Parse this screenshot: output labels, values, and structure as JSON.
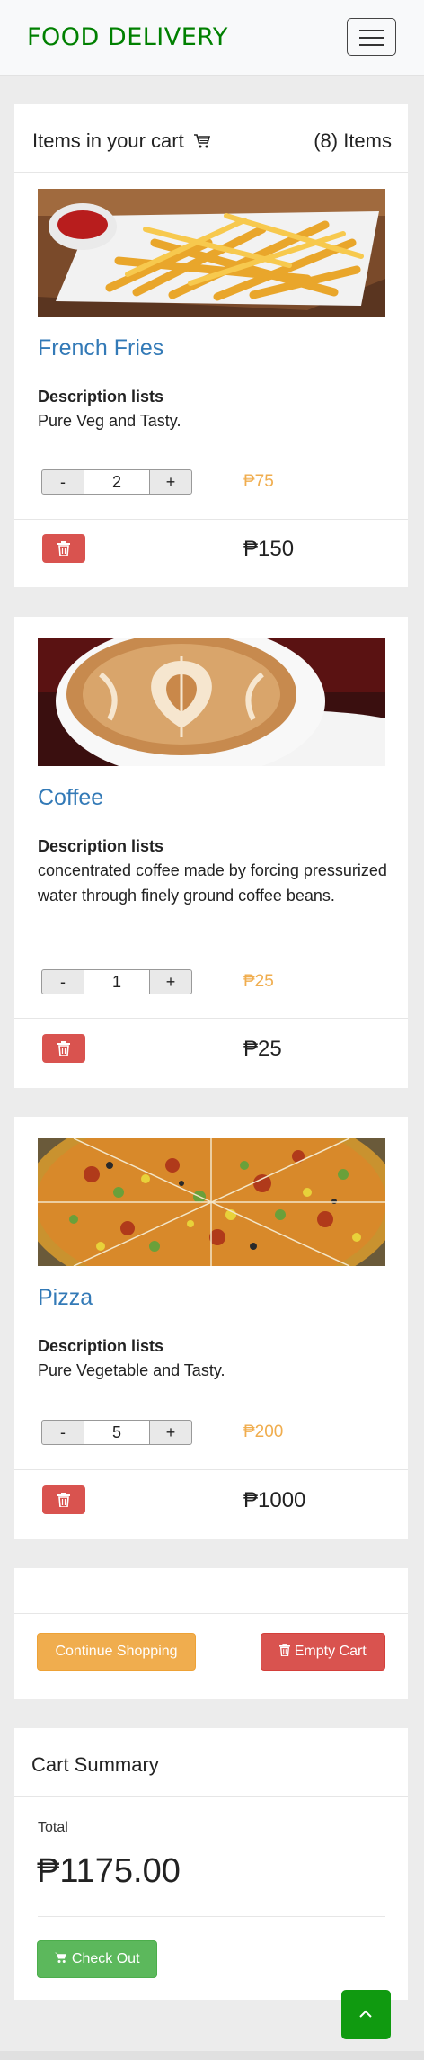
{
  "navbar": {
    "brand": "FOOD DELIVERY",
    "menu_icon": "hamburger-icon"
  },
  "cart": {
    "title": "Items in your cart",
    "cart_icon": "cart-icon",
    "count": "(8) Items",
    "items": [
      {
        "name": "French Fries",
        "image": "french-fries-photo",
        "desc_label": "Description lists",
        "description": "Pure Veg and Tasty.",
        "minus_label": "-",
        "quantity": "2",
        "plus_label": "+",
        "unit_price": "₱75",
        "line_total": "₱150"
      },
      {
        "name": "Coffee",
        "image": "coffee-photo",
        "desc_label": "Description lists",
        "description": "concentrated coffee made by forcing pressurized water through finely ground coffee beans.",
        "minus_label": "-",
        "quantity": "1",
        "plus_label": "+",
        "unit_price": "₱25",
        "line_total": "₱25"
      },
      {
        "name": "Pizza",
        "image": "pizza-photo",
        "desc_label": "Description lists",
        "description": "Pure Vegetable and Tasty.",
        "minus_label": "-",
        "quantity": "5",
        "plus_label": "+",
        "unit_price": "₱200",
        "line_total": "₱1000"
      }
    ]
  },
  "actions": {
    "continue_label": "Continue Shopping",
    "empty_label": "Empty Cart"
  },
  "summary": {
    "title": "Cart Summary",
    "total_label": "Total",
    "total_value": "₱1175.00",
    "checkout_label": "Check Out"
  },
  "colors": {
    "brand": "#008000",
    "link": "#337ab7",
    "price": "#f0ad4e",
    "danger": "#d9534f",
    "success": "#5cb85c",
    "scroll_top": "#109a10"
  }
}
